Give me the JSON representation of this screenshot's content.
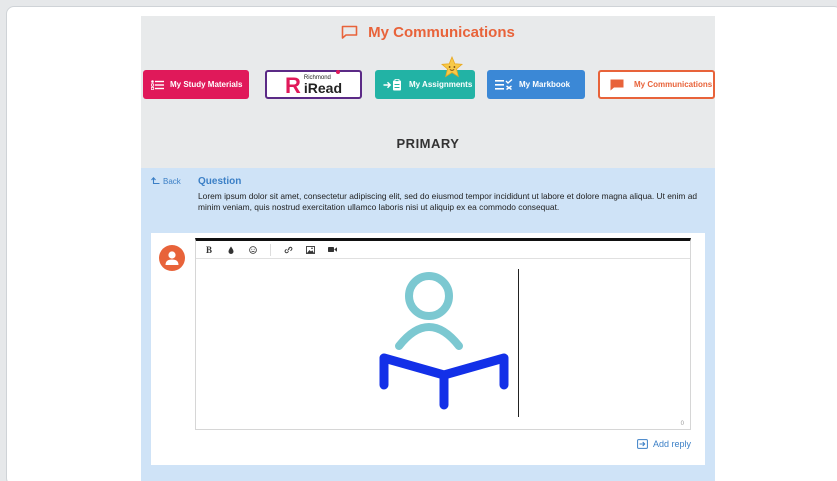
{
  "header": {
    "title": "My Communications"
  },
  "nav": {
    "study_label": "My Study Materials",
    "iread_small": "Richmond",
    "iread_big": "iRead",
    "assign_label": "My Assignments",
    "mark_label": "My Markbook",
    "comm_label": "My Communications"
  },
  "section": {
    "title": "PRIMARY"
  },
  "question": {
    "back_label": "Back",
    "label": "Question",
    "text": "Lorem ipsum dolor sit amet, consectetur adipiscing elit, sed do eiusmod tempor incididunt ut labore et dolore magna aliqua. Ut enim ad minim veniam, quis nostrud exercitation ullamco laboris nisi ut aliquip ex ea commodo consequat."
  },
  "editor": {
    "bold_label": "B",
    "counter": "0"
  },
  "reply": {
    "add_label": "Add reply"
  },
  "colors": {
    "accent_orange": "#e8633a",
    "study_pink": "#e0195a",
    "assign_teal": "#22b3a5",
    "mark_blue": "#3b88d6",
    "panel_blue": "#cfe3f7",
    "link_blue": "#3b7fc6"
  },
  "icons": [
    "chat-icon",
    "list-icon",
    "arrow-clipboard-icon",
    "checklist-icon",
    "star-icon",
    "back-arrow-icon",
    "user-icon",
    "drop-icon",
    "smiley-icon",
    "link-icon",
    "image-icon",
    "video-icon",
    "reply-icon",
    "reader-illustration"
  ]
}
